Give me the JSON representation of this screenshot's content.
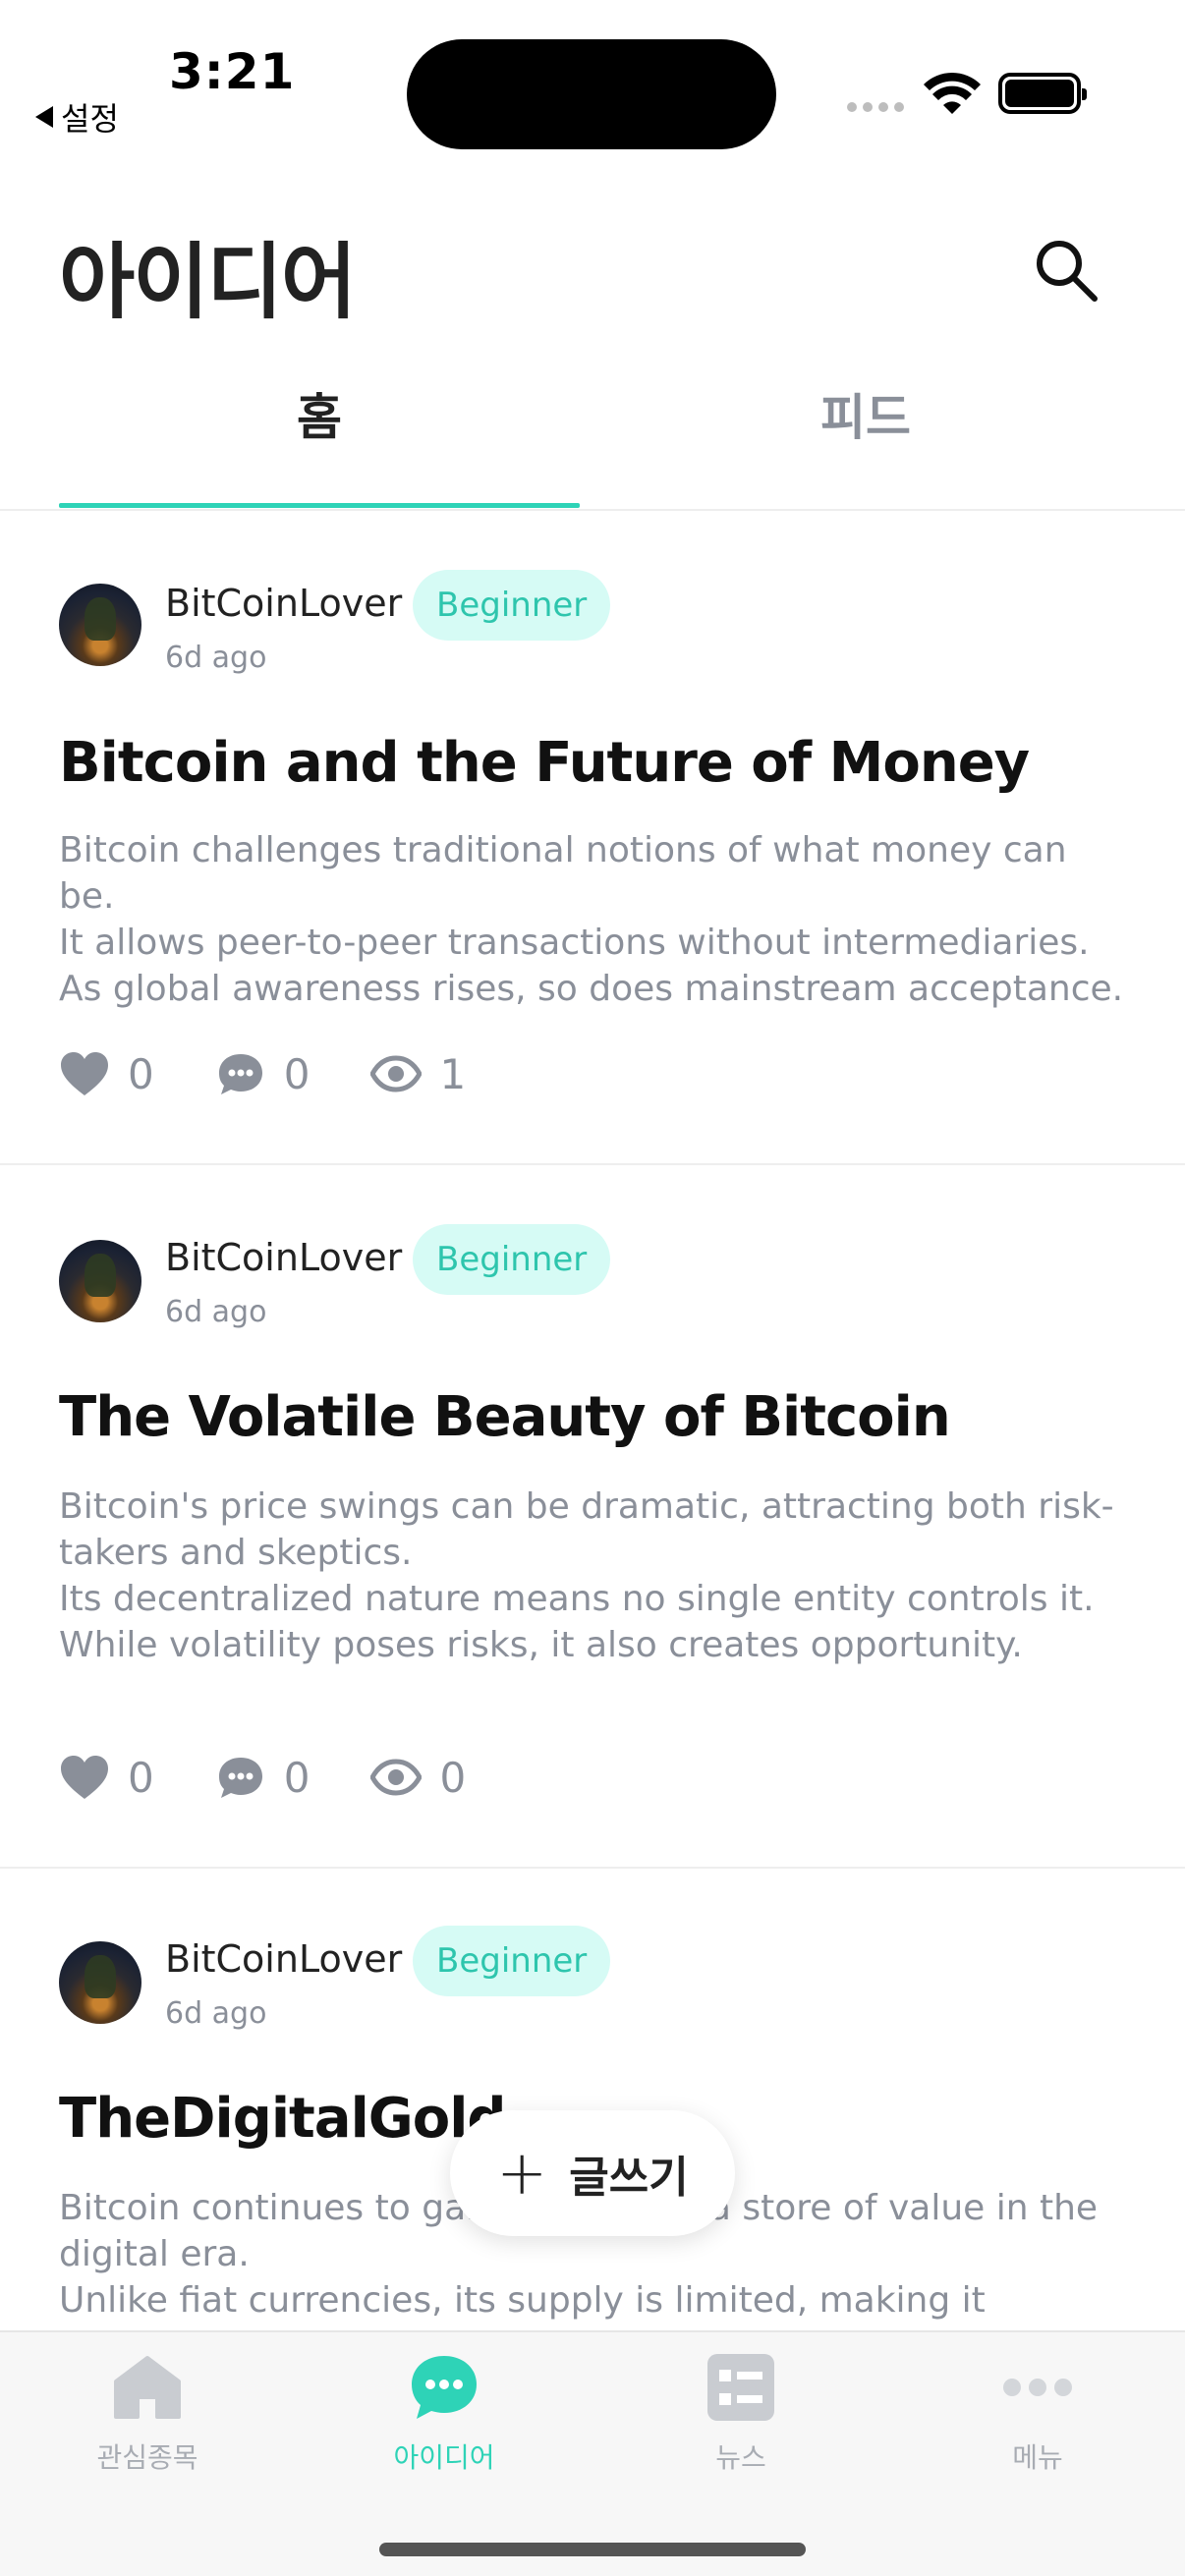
{
  "status_bar": {
    "time": "3:21",
    "back_label": "설정"
  },
  "header": {
    "title": "아이디어"
  },
  "tabs": [
    {
      "label": "홈",
      "active": true
    },
    {
      "label": "피드",
      "active": false
    }
  ],
  "posts": [
    {
      "author": "BitCoinLover",
      "badge": "Beginner",
      "time_ago": "6d ago",
      "title": "Bitcoin and the Future of Money",
      "body": [
        "Bitcoin challenges traditional notions of what money can be.",
        "It allows peer-to-peer transactions without intermediaries.",
        "As global awareness rises, so does mainstream acceptance."
      ],
      "likes": "0",
      "comments": "0",
      "views": "1"
    },
    {
      "author": "BitCoinLover",
      "badge": "Beginner",
      "time_ago": "6d ago",
      "title": "The Volatile Beauty of Bitcoin",
      "body": [
        "Bitcoin's price swings can be dramatic, attracting both risk-takers and skeptics.",
        "Its decentralized nature means no single entity controls it.",
        "While volatility poses risks, it also creates opportunity."
      ],
      "likes": "0",
      "comments": "0",
      "views": "0"
    },
    {
      "author": "BitCoinLover",
      "badge": "Beginner",
      "time_ago": "6d ago",
      "title": "TheDigitalGold",
      "body": [
        "Bitcoin continues to gain traction as a store of value in the digital era.",
        "Unlike fiat currencies, its supply is limited, making it resistant"
      ],
      "likes": "",
      "comments": "",
      "views": ""
    }
  ],
  "write_button": {
    "label": "글쓰기"
  },
  "bottom_nav": [
    {
      "label": "관심종목",
      "icon": "home-icon",
      "active": false
    },
    {
      "label": "아이디어",
      "icon": "chat-bubble-icon",
      "active": true
    },
    {
      "label": "뉴스",
      "icon": "news-list-icon",
      "active": false
    },
    {
      "label": "메뉴",
      "icon": "more-dots-icon",
      "active": false
    }
  ],
  "colors": {
    "accent": "#2ed3b7",
    "badge_bg": "#d6fbf5",
    "badge_text": "#2ec5ad",
    "muted": "#8a8f99"
  }
}
